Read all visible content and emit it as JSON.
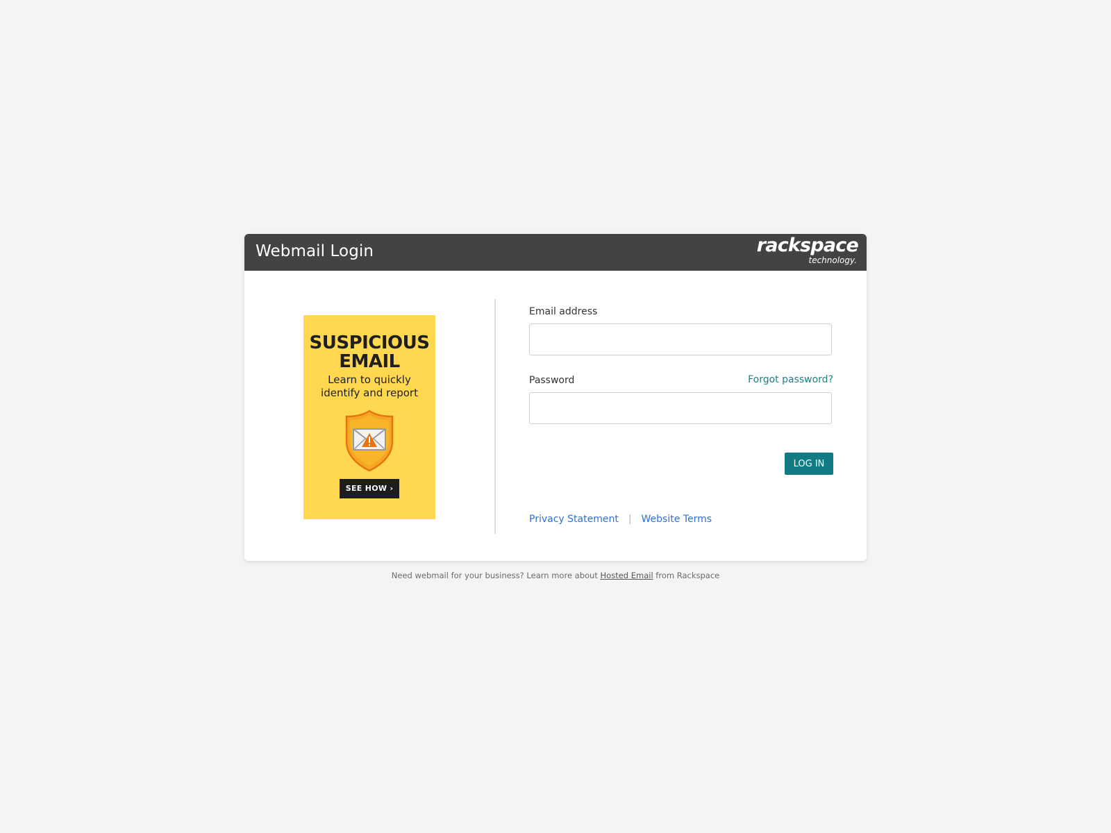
{
  "header": {
    "title": "Webmail Login",
    "brand_main": "rackspace",
    "brand_sub": "technology."
  },
  "ad": {
    "title_line1": "SUSPICIOUS",
    "title_line2": "EMAIL",
    "subtitle_line1": "Learn to quickly",
    "subtitle_line2": "identify and report",
    "button_label": "SEE HOW",
    "button_icon": "chevron-right-icon",
    "icon": "shield-warning-envelope-icon",
    "background_color": "#ffd84f"
  },
  "form": {
    "email_label": "Email address",
    "email_value": "",
    "password_label": "Password",
    "password_value": "",
    "forgot_label": "Forgot password?",
    "login_label": "LOG IN",
    "accent_color": "#127a82"
  },
  "links": {
    "privacy": "Privacy Statement",
    "separator": "|",
    "terms": "Website Terms"
  },
  "footer": {
    "prefix": "Need webmail for your business? Learn more about ",
    "link": "Hosted Email",
    "suffix": " from Rackspace"
  }
}
